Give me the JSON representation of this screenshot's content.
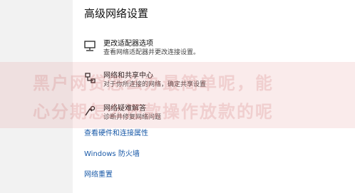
{
  "page_title": "高级网络设置",
  "items": [
    {
      "icon": "network-adapter-icon",
      "title": "更改适配器选项",
      "desc": "查看网络适配器并更改连接设置。"
    },
    {
      "icon": "network-sharing-icon",
      "title": "网络和共享中心",
      "desc": "对于你所连接的网络，确定共享设置"
    },
    {
      "icon": "network-troubleshoot-icon",
      "title": "网络疑难解答",
      "desc": "诊断并修复网络问题"
    }
  ],
  "watermark": [
    "黑户网贷怎么办最简单呢，能",
    "心分期怎么还款操作放款的呢"
  ],
  "links": {
    "hardware_properties": "查看硬件和连接属性",
    "firewall": "Windows 防火墙",
    "network_reset": "网络重置"
  }
}
